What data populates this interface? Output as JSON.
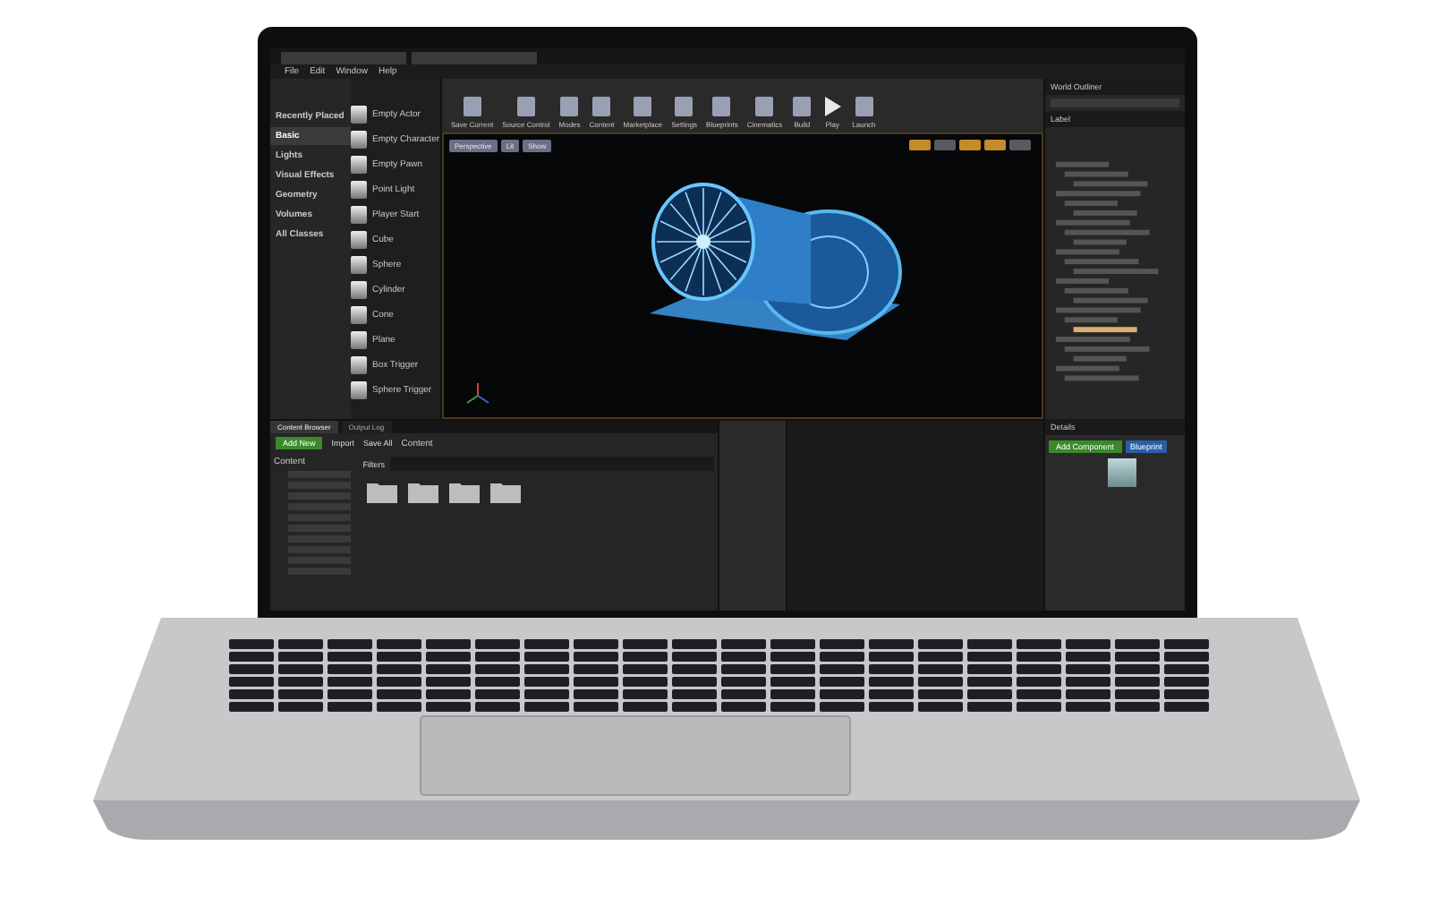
{
  "menu": [
    "File",
    "Edit",
    "Window",
    "Help"
  ],
  "place_panel": {
    "categories": [
      {
        "label": "Recently Placed",
        "selected": false
      },
      {
        "label": "Basic",
        "selected": true
      },
      {
        "label": "Lights",
        "selected": false
      },
      {
        "label": "Visual Effects",
        "selected": false
      },
      {
        "label": "Geometry",
        "selected": false
      },
      {
        "label": "Volumes",
        "selected": false
      },
      {
        "label": "All Classes",
        "selected": false
      }
    ],
    "items": [
      "Empty Actor",
      "Empty Character",
      "Empty Pawn",
      "Point Light",
      "Player Start",
      "Cube",
      "Sphere",
      "Cylinder",
      "Cone",
      "Plane",
      "Box Trigger",
      "Sphere Trigger"
    ]
  },
  "toolbar": [
    {
      "label": "Save Current",
      "kind": "tool"
    },
    {
      "label": "Source Control",
      "kind": "tool"
    },
    {
      "label": "Modes",
      "kind": "tool"
    },
    {
      "label": "Content",
      "kind": "tool"
    },
    {
      "label": "Marketplace",
      "kind": "tool"
    },
    {
      "label": "Settings",
      "kind": "tool"
    },
    {
      "label": "Blueprints",
      "kind": "tool"
    },
    {
      "label": "Cinematics",
      "kind": "tool"
    },
    {
      "label": "Build",
      "kind": "tool"
    },
    {
      "label": "Play",
      "kind": "play"
    },
    {
      "label": "Launch",
      "kind": "tool"
    }
  ],
  "viewport": {
    "buttons": [
      "Perspective",
      "Lit",
      "Show"
    ],
    "snaps": [
      {
        "on": true
      },
      {
        "on": false
      },
      {
        "on": true
      },
      {
        "on": true
      },
      {
        "on": false
      }
    ]
  },
  "outliner": {
    "title": "World Outliner",
    "column": "Label"
  },
  "content_browser": {
    "tabs": [
      {
        "label": "Content Browser",
        "selected": true
      },
      {
        "label": "Output Log",
        "selected": false
      }
    ],
    "add_button": "Add New",
    "actions": [
      "Import",
      "Save All"
    ],
    "path": "Content",
    "filters": "Filters",
    "tree_root": "Content"
  },
  "details": {
    "title": "Details",
    "add_button": "Add Component",
    "blueprint_button": "Blueprint"
  }
}
